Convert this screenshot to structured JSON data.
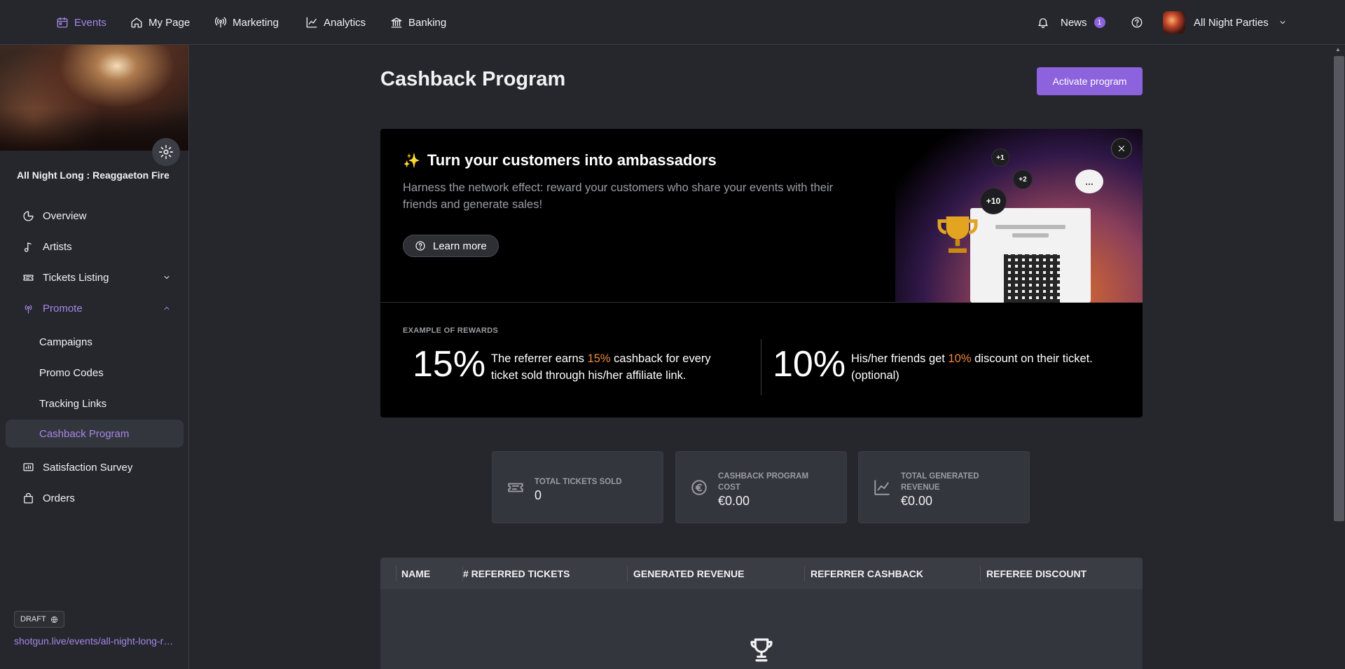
{
  "nav": {
    "events": "Events",
    "my_page": "My Page",
    "marketing": "Marketing",
    "analytics": "Analytics",
    "banking": "Banking",
    "news": "News",
    "news_count": "1",
    "org_name": "All Night Parties"
  },
  "sidebar": {
    "event_title": "All Night Long : Reaggaeton Fire",
    "items": {
      "overview": "Overview",
      "artists": "Artists",
      "tickets_listing": "Tickets Listing",
      "promote": "Promote",
      "campaigns": "Campaigns",
      "promo_codes": "Promo Codes",
      "tracking_links": "Tracking Links",
      "cashback_program": "Cashback Program",
      "satisfaction_survey": "Satisfaction Survey",
      "orders": "Orders"
    },
    "status": "DRAFT",
    "event_link": "shotgun.live/events/all-night-long-reaggaeton-fire"
  },
  "main": {
    "page_title": "Cashback Program",
    "activate_button": "Activate program",
    "hero": {
      "title": "Turn your customers into ambassadors",
      "subtitle": "Harness the network effect: reward your customers who share your events with their friends and generate sales!",
      "learn_more": "Learn more",
      "bubbles": [
        "+1",
        "+2",
        "+10"
      ],
      "chat": "..."
    },
    "rewards": {
      "label": "EXAMPLE OF REWARDS",
      "referrer_pct": "15%",
      "referrer_pre": "The referrer earns ",
      "referrer_hl": "15%",
      "referrer_post": " cashback for every ticket sold through his/her affiliate link.",
      "friends_pct": "10%",
      "friends_pre": "His/her friends get ",
      "friends_hl": "10%",
      "friends_post": " discount on their ticket. (optional)"
    },
    "stats": [
      {
        "label": "TOTAL TICKETS SOLD",
        "value": "0",
        "icon": "ticket-icon"
      },
      {
        "label": "CASHBACK PROGRAM COST",
        "value": "€0.00",
        "icon": "euro-icon"
      },
      {
        "label": "TOTAL GENERATED REVENUE",
        "value": "€0.00",
        "icon": "chart-line-icon"
      }
    ],
    "table": {
      "columns": [
        "NAME",
        "# REFERRED TICKETS",
        "GENERATED REVENUE",
        "REFERRER CASHBACK",
        "REFEREE DISCOUNT"
      ]
    }
  },
  "colors": {
    "accent": "#8c63dd",
    "accent_text": "#a587e6",
    "highlight": "#f08a3c",
    "background": "#25272d"
  }
}
